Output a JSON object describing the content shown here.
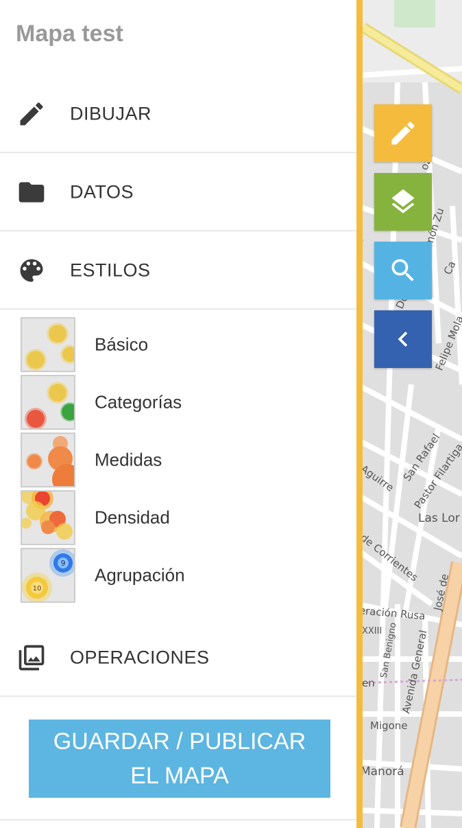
{
  "sidebar": {
    "title": "Mapa test",
    "menu": [
      {
        "label": "DIBUJAR",
        "icon": "pencil-icon"
      },
      {
        "label": "DATOS",
        "icon": "folder-icon"
      },
      {
        "label": "ESTILOS",
        "icon": "palette-icon"
      },
      {
        "label": "OPERACIONES",
        "icon": "photo-library-icon"
      }
    ],
    "styles": [
      {
        "label": "Básico",
        "thumb": "basic-style-thumbnail"
      },
      {
        "label": "Categorías",
        "thumb": "categories-style-thumbnail"
      },
      {
        "label": "Medidas",
        "thumb": "measures-style-thumbnail"
      },
      {
        "label": "Densidad",
        "thumb": "density-style-thumbnail"
      },
      {
        "label": "Agrupación",
        "thumb": "clustering-style-thumbnail"
      }
    ],
    "cluster_counts": [
      "9",
      "10"
    ],
    "publish_button": {
      "line1": "GUARDAR / PUBLICAR",
      "line2": "EL MAPA"
    }
  },
  "map": {
    "buttons": [
      {
        "name": "draw",
        "icon": "pencil-icon",
        "color": "#f5bb3d"
      },
      {
        "name": "layers",
        "icon": "layers-icon",
        "color": "#86b33e"
      },
      {
        "name": "search",
        "icon": "search-icon",
        "color": "#55b3e3"
      },
      {
        "name": "collapse",
        "icon": "chevron-left-icon",
        "color": "#3562b0"
      }
    ],
    "labels": {
      "pozo": "ozo",
      "ramon": "Doctor Ramón Zu",
      "ca": "Ca",
      "do": "Do",
      "felipe": "Felipe Mola",
      "aguirre": "Aguirre",
      "san_rafael": "San Rafael",
      "pastor": "Pastor Filartiga",
      "las_lomas": "Las Lor",
      "corrientes": "de Corrientes",
      "federacion": "eración Rusa",
      "jose": "José de",
      "xxiii": "XXIII",
      "benigno": "San Benigno",
      "avenida": "Avenida General",
      "migone": "Migone",
      "en": "en",
      "manora": "Manorá"
    }
  },
  "colors": {
    "accent_divider": "#f5bb3d",
    "publish_button": "#5db5e1",
    "title_gray": "#999999"
  }
}
